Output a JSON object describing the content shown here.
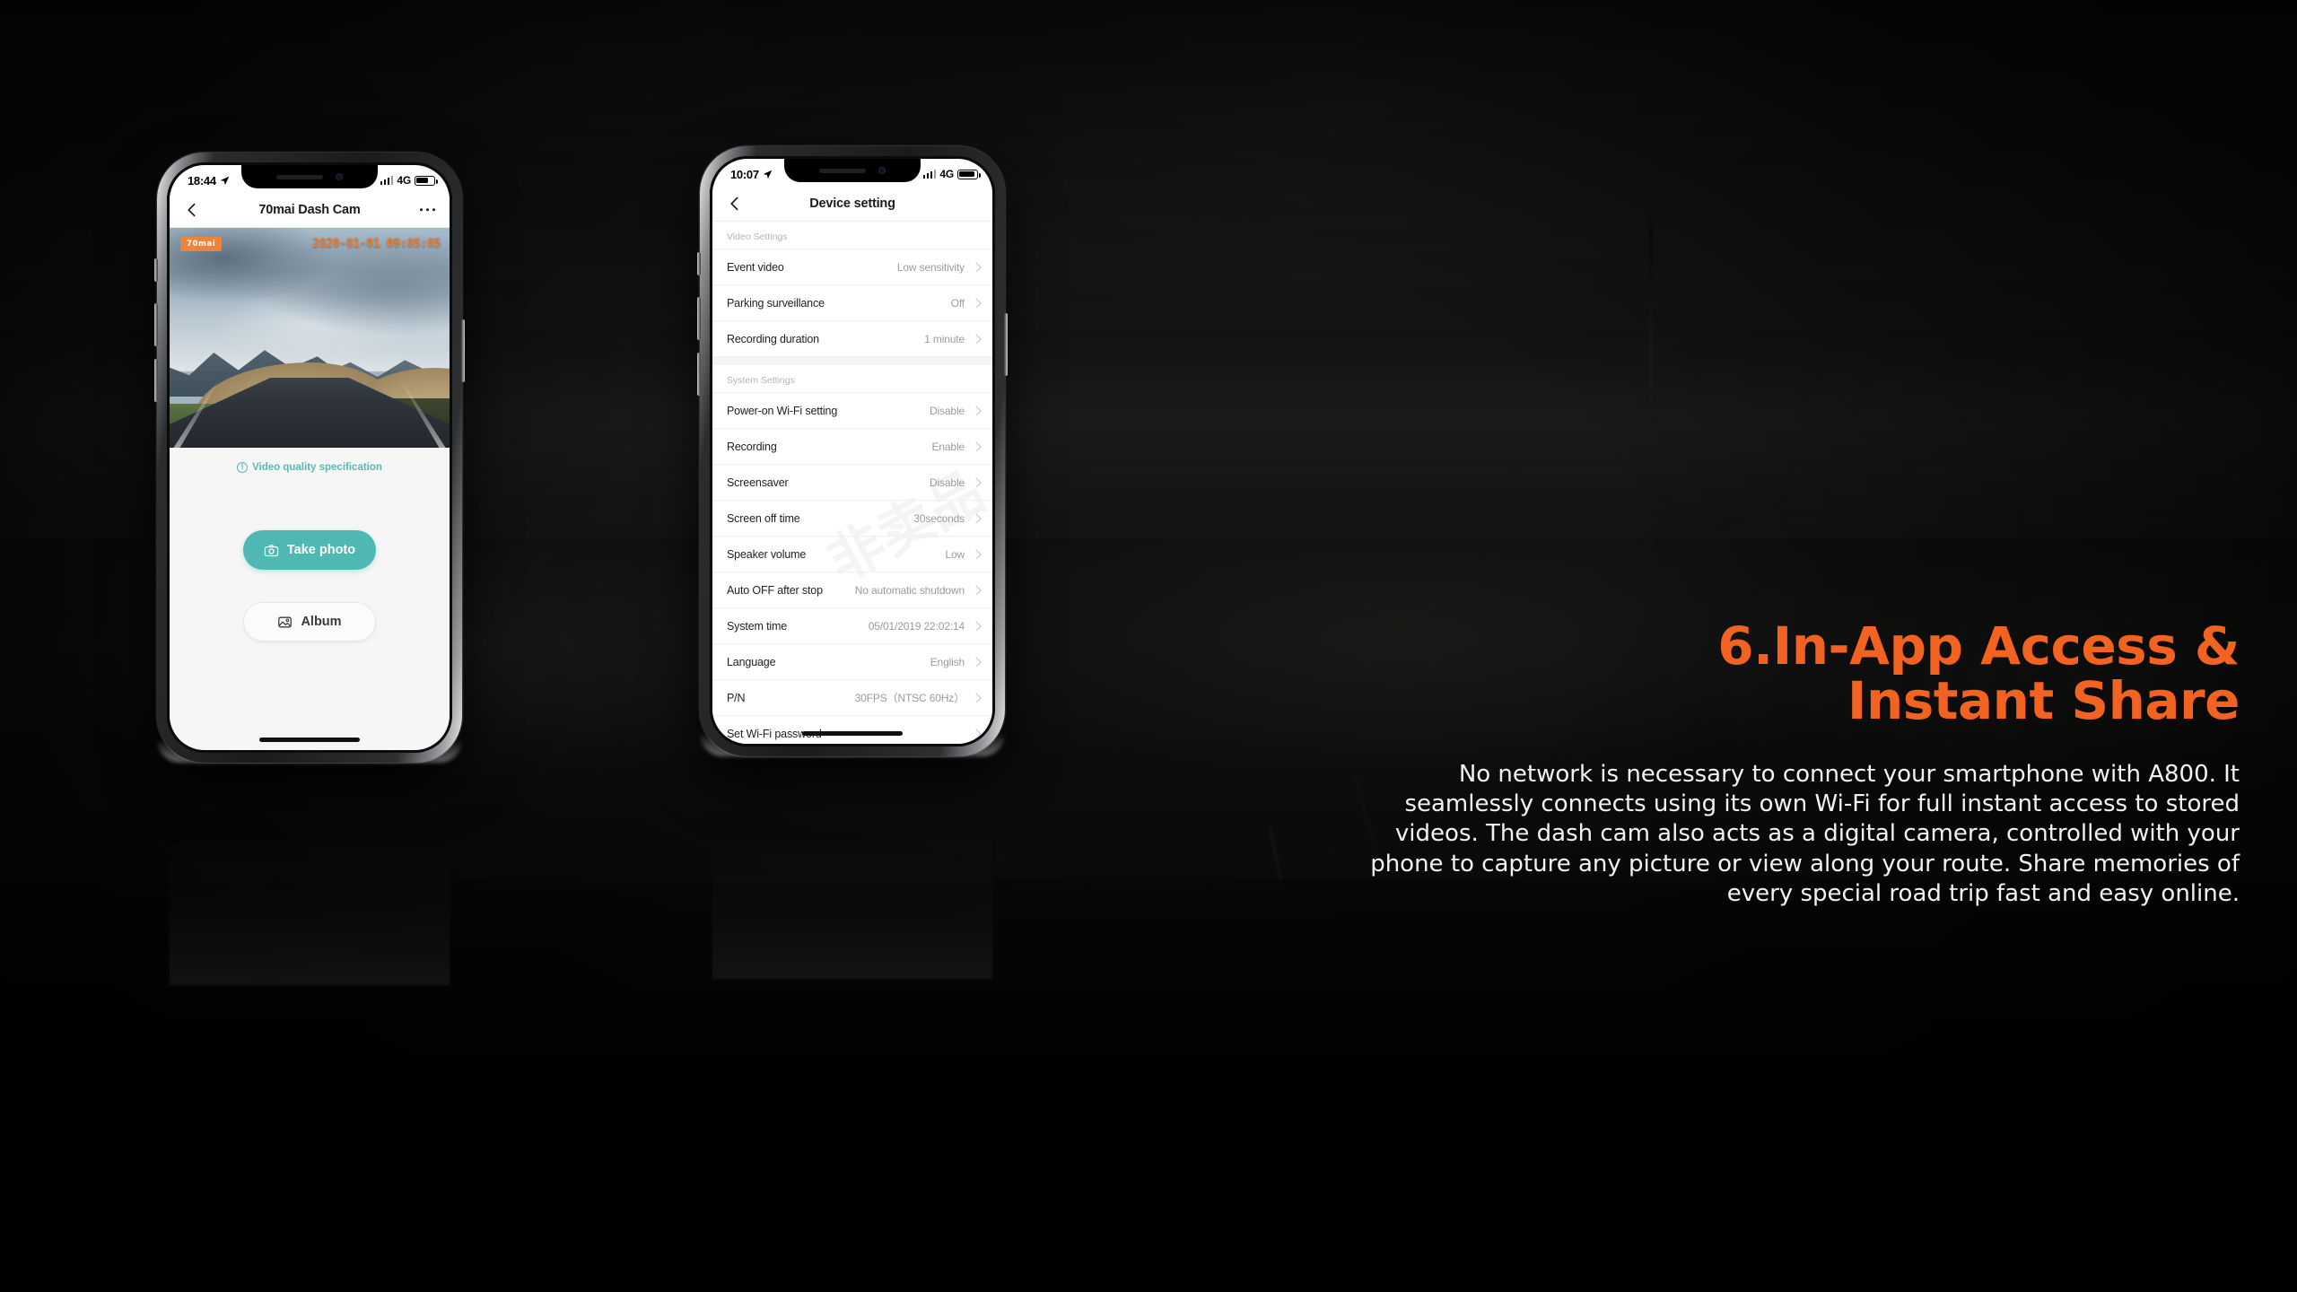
{
  "phone_left": {
    "status_bar": {
      "time": "18:44",
      "network": "4G",
      "location_icon": "location-arrow-icon",
      "battery_icon": "battery-icon",
      "signal_icon": "signal-bars-icon"
    },
    "navbar": {
      "title": "70mai Dash Cam",
      "back_icon": "chevron-left-icon",
      "more_icon": "more-dots-icon"
    },
    "camera_feed": {
      "brand_badge": "70mai",
      "timestamp": "2020-01-01 09:05:05"
    },
    "spec_link": {
      "label": "Video quality specification",
      "icon": "info-circle-icon"
    },
    "buttons": {
      "take_photo": {
        "label": "Take photo",
        "icon": "camera-icon"
      },
      "album": {
        "label": "Album",
        "icon": "image-icon"
      }
    }
  },
  "phone_right": {
    "status_bar": {
      "time": "10:07",
      "network": "4G",
      "location_icon": "location-arrow-icon",
      "battery_icon": "battery-icon",
      "signal_icon": "signal-bars-icon"
    },
    "navbar": {
      "title": "Device setting",
      "back_icon": "chevron-left-icon"
    },
    "watermark": "非卖品",
    "sections": [
      {
        "header": "Video Settings",
        "rows": [
          {
            "label": "Event video",
            "value": "Low sensitivity"
          },
          {
            "label": "Parking surveillance",
            "value": "Off"
          },
          {
            "label": "Recording duration",
            "value": "1 minute"
          }
        ]
      },
      {
        "header": "System Settings",
        "rows": [
          {
            "label": "Power-on Wi-Fi setting",
            "value": "Disable"
          },
          {
            "label": "Recording",
            "value": "Enable"
          },
          {
            "label": "Screensaver",
            "value": "Disable"
          },
          {
            "label": "Screen off time",
            "value": "30seconds"
          },
          {
            "label": "Speaker volume",
            "value": "Low"
          },
          {
            "label": "Auto OFF after stop",
            "value": "No automatic shutdown"
          },
          {
            "label": "System time",
            "value": "05/01/2019 22:02:14"
          },
          {
            "label": "Language",
            "value": "English"
          },
          {
            "label": "P/N",
            "value": "30FPS（NTSC 60Hz）"
          },
          {
            "label": "Set Wi-Fi password",
            "value": ""
          }
        ]
      }
    ]
  },
  "marketing": {
    "headline_line1": "6.In-App Access &",
    "headline_line2": "Instant Share",
    "body": "No network is necessary to connect your smartphone with A800. It seamlessly connects using its own Wi-Fi for full instant access to stored videos. The dash cam also acts as a digital camera, controlled with your phone to capture any picture or view along your route. Share memories of every special road trip fast and easy online."
  },
  "colors": {
    "accent_orange": "#f26322",
    "brand_orange": "#e9853d",
    "teal": "#4fb8b3",
    "link_teal": "#5ab8b3",
    "timestamp_orange": "#ef7c2b",
    "background": "#050505"
  }
}
